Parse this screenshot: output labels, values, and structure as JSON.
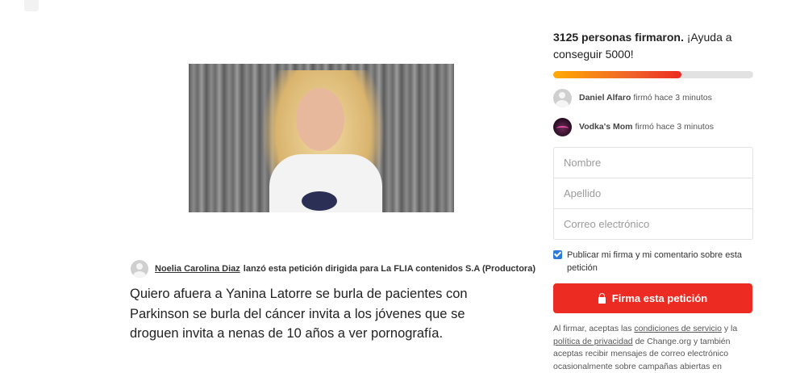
{
  "petition": {
    "creator_name": "Noelia Carolina Diaz",
    "creator_text": "lanzó esta petición dirigida para La FLIA contenidos S.A (Productora)",
    "body": "Quiero afuera a Yanina Latorre se burla de pacientes con Parkinson se burla del cáncer invita a los jóvenes que se droguen invita a nenas de 10 años a ver pornografía."
  },
  "sidebar": {
    "count_bold": "3125 personas firmaron.",
    "count_rest": " ¡Ayuda a conseguir 5000!",
    "progress_fraction": 0.64,
    "signers": [
      {
        "name": "Daniel Alfaro",
        "action": "firmó hace 3 minutos",
        "icon": "user-avatar-icon"
      },
      {
        "name": "Vodka's Mom",
        "action": "firmó hace 3 minutos",
        "icon": "user-photo-avatar"
      }
    ]
  },
  "form": {
    "name_placeholder": "Nombre",
    "lastname_placeholder": "Apellido",
    "email_placeholder": "Correo electrónico",
    "publish_label": "Publicar mi firma y mi comentario sobre esta petición",
    "publish_checked": true,
    "sign_button_label": "Firma esta petición",
    "sign_button_icon": "lock-icon"
  },
  "disclaimer": {
    "part1": "Al firmar, aceptas las ",
    "terms_link": "condiciones de servicio",
    "part2": " y la ",
    "privacy_link": "política de privacidad",
    "part3": " de Change.org y también aceptas recibir mensajes de correo electrónico ocasionalmente sobre campañas abiertas en"
  },
  "colors": {
    "accent": "#ec2c22",
    "progress_start": "#ffab00",
    "checkbox": "#2e7ad8"
  }
}
